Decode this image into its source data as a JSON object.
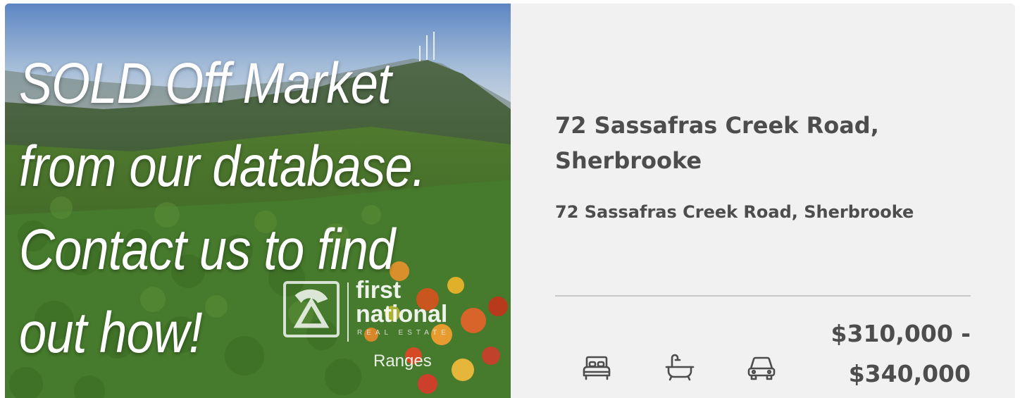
{
  "promo": {
    "lines": [
      "SOLD Off Market",
      "from our database.",
      "Contact us to find",
      "out how!"
    ]
  },
  "brand": {
    "line1": "first",
    "line2": "national",
    "line3": "REAL ESTATE",
    "line4": "Ranges"
  },
  "listing": {
    "headline_line1": "72 Sassafras Creek Road,",
    "headline_line2": "Sherbrooke",
    "address": "72 Sassafras Creek Road, Sherbrooke",
    "price_line1": "$310,000 -",
    "price_line2": "$340,000",
    "features": [
      {
        "icon": "bed-icon"
      },
      {
        "icon": "bath-icon"
      },
      {
        "icon": "car-icon"
      }
    ]
  },
  "colors": {
    "card_background": "#f1f1f1",
    "text": "#4d4d4d",
    "divider": "#c8c8c8"
  }
}
